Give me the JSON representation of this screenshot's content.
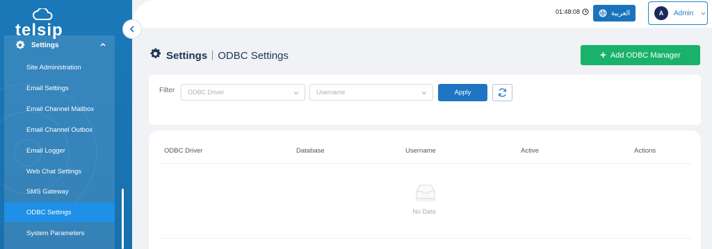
{
  "brand": {
    "name": "telsip",
    "icon": "cloud-icon"
  },
  "sidebar": {
    "group_label": "Settings",
    "items": [
      {
        "label": "Site Administration"
      },
      {
        "label": "Email Settings"
      },
      {
        "label": "Email Channel Mailbox"
      },
      {
        "label": "Email Channel Outbox"
      },
      {
        "label": "Email Logger"
      },
      {
        "label": "Web Chat Settings"
      },
      {
        "label": "SMS Gateway"
      },
      {
        "label": "ODBC Settings",
        "active": true
      },
      {
        "label": "System Parameters"
      }
    ]
  },
  "header": {
    "time": "01:48:08",
    "language_label": "العربية",
    "user_initial": "A",
    "user_name": "Admin"
  },
  "page": {
    "title": "Settings",
    "subtitle": "ODBC Settings",
    "add_button": "Add ODBC Manager"
  },
  "filter": {
    "label": "Filter",
    "driver_placeholder": "ODBC Driver",
    "username_placeholder": "Username",
    "apply_label": "Apply"
  },
  "table": {
    "columns": [
      "ODBC Driver",
      "Database",
      "Username",
      "Active",
      "Actions"
    ],
    "rows": [],
    "empty_text": "No Data"
  },
  "colors": {
    "sidebar": "#1b78b8",
    "active_item": "#1e90e8",
    "primary": "#1e75c3",
    "success": "#19b26b",
    "title": "#1d3557"
  }
}
